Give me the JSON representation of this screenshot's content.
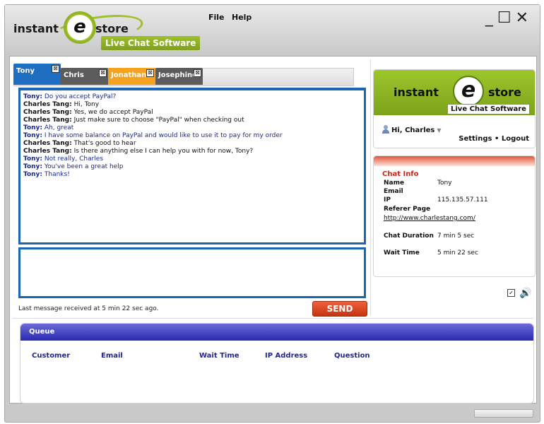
{
  "app": {
    "logo_word1": "instant",
    "logo_letter": "e",
    "logo_word2": "store",
    "tagline": "Live Chat Software"
  },
  "menu": {
    "file": "File",
    "help": "Help"
  },
  "window_controls": {
    "minimize": "_",
    "maximize": "☐",
    "close": "✕"
  },
  "tabs": [
    {
      "label": "Tony",
      "color": "#1e6fc2",
      "active": true
    },
    {
      "label": "Chris",
      "color": "#5c5c5c"
    },
    {
      "label": "Jonathan",
      "color": "#f5a21e"
    },
    {
      "label": "Josephine",
      "color": "#5c5c5c"
    }
  ],
  "tab_close_glyph": "⊠",
  "messages": [
    {
      "who": "Tony:",
      "text": "Do you accept PayPal?",
      "kind": "cust"
    },
    {
      "who": "Charles Tang:",
      "text": "Hi, Tony",
      "kind": "agent"
    },
    {
      "who": "Charles Tang:",
      "text": "Yes, we do accept PayPal",
      "kind": "agent"
    },
    {
      "who": "Charles Tang:",
      "text": "Just make sure to choose \"PayPal\" when checking out",
      "kind": "agent"
    },
    {
      "who": "Tony:",
      "text": "Ah, great",
      "kind": "cust"
    },
    {
      "who": "Tony:",
      "text": "I have some balance on PayPal and would like to use it to pay for my order",
      "kind": "cust"
    },
    {
      "who": "Charles Tang:",
      "text": "That's good to hear",
      "kind": "agent"
    },
    {
      "who": "Charles Tang:",
      "text": "Is there anything else I can help you with for now, Tony?",
      "kind": "agent"
    },
    {
      "who": "Tony:",
      "text": "Not really, Charles",
      "kind": "cust"
    },
    {
      "who": "Tony:",
      "text": "You've been a great help",
      "kind": "cust"
    },
    {
      "who": "Tony:",
      "text": "Thanks!",
      "kind": "cust"
    }
  ],
  "composer": {
    "value": "",
    "send_label": "SEND"
  },
  "status_text": "Last message received at 5 min 22 sec ago.",
  "sidebar": {
    "brand": {
      "word1": "instant",
      "letter": "e",
      "word2": "store",
      "tagline": "Live Chat Software"
    },
    "greeting": "Hi, Charles",
    "settings_label": "Settings",
    "separator": "•",
    "logout_label": "Logout"
  },
  "chat_info": {
    "title": "Chat Info",
    "name_label": "Name",
    "name_value": "Tony",
    "email_label": "Email",
    "email_value": "",
    "ip_label": "IP",
    "ip_value": "115.135.57.111",
    "referer_label": "Referer Page",
    "referer_value": "http://www.charlestang.com/",
    "duration_label": "Chat Duration",
    "duration_value": "7 min 5 sec",
    "wait_label": "Wait Time",
    "wait_value": "5 min 22 sec"
  },
  "sound": {
    "checked": true,
    "checkbox_glyph": "☑",
    "speaker_glyph": "🔊"
  },
  "queue": {
    "title": "Queue",
    "columns": [
      "Customer",
      "Email",
      "Wait Time",
      "IP Address",
      "Question"
    ],
    "rows": []
  }
}
